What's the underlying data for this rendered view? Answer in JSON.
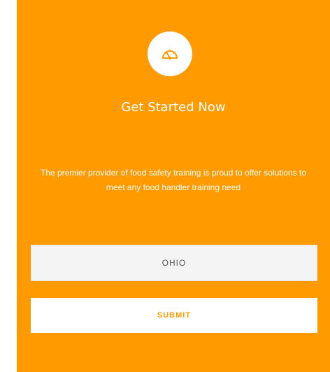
{
  "colors": {
    "panel_background": "#ff9a00",
    "accent": "#ff9a00",
    "text_on_panel": "#ffffff",
    "input_background": "#f4f4f4"
  },
  "header": {
    "icon": "speedometer-icon",
    "title": "Get Started Now"
  },
  "description": "The premier provider of food safety training is proud to offer solutions to meet any food handler training need",
  "form": {
    "state_value": "OHIO",
    "submit_label": "SUBMIT"
  }
}
